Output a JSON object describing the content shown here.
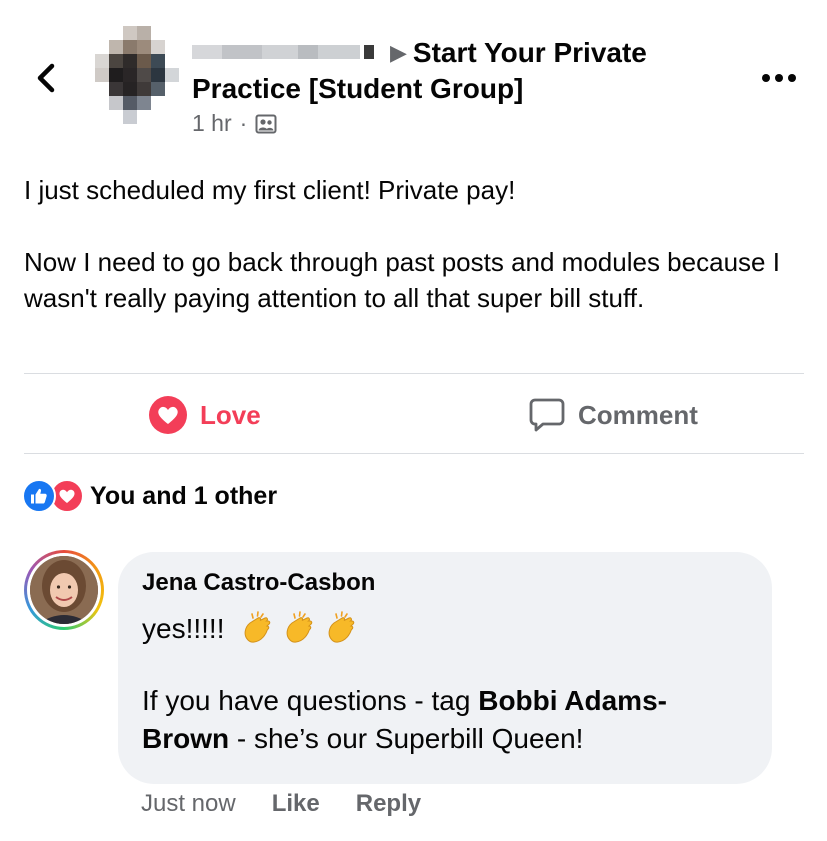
{
  "header": {
    "group_name_line1": "Start Your Private",
    "group_name_line2": "Practice [Student Group]",
    "time": "1 hr",
    "meta_separator": "·",
    "audience_icon": "group-audience-icon"
  },
  "post": {
    "paragraph1": "I just scheduled my first client! Private pay!",
    "paragraph2": "Now I need to go back through past posts and modules because I wasn't really paying attention to all that super bill stuff."
  },
  "actions": {
    "love_label": "Love",
    "comment_label": "Comment"
  },
  "reactions": {
    "summary": "You and 1 other"
  },
  "comment": {
    "author": "Jena Castro-Casbon",
    "line1": "yes!!!!!",
    "line2_prefix": "If you have questions - tag ",
    "mention": "Bobbi Adams-Brown",
    "line2_suffix": " - she’s our Superbill Queen!",
    "time": "Just now",
    "like_label": "Like",
    "reply_label": "Reply"
  },
  "colors": {
    "love_red": "#f33e58",
    "like_blue": "#1877f2",
    "secondary_text": "#65676b",
    "bubble_bg": "#f0f2f5"
  }
}
